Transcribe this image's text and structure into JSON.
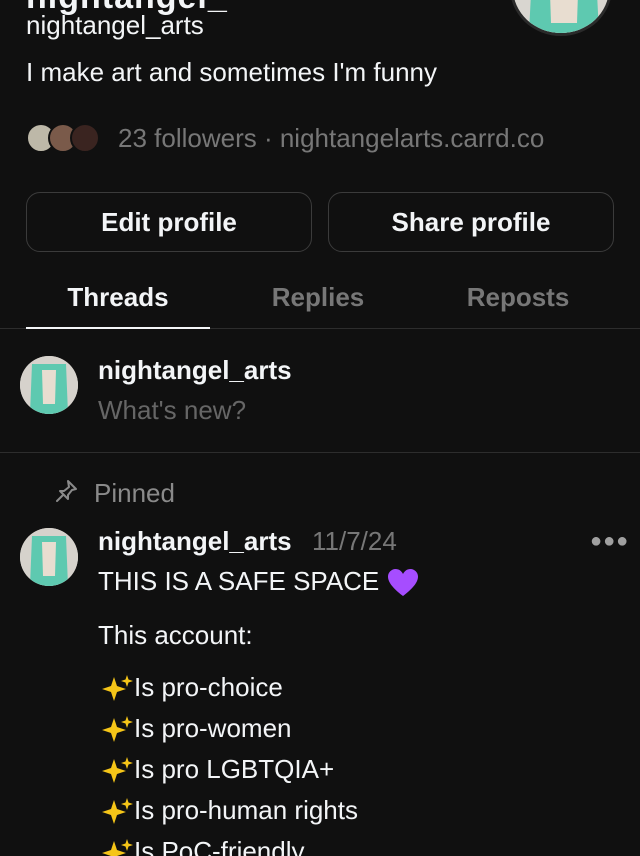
{
  "profile": {
    "clipped_name": "nightangel_",
    "handle": "nightangel_arts",
    "bio": "I make art and sometimes I'm funny",
    "followers_text": "23 followers · nightangelarts.carrd.co"
  },
  "buttons": {
    "edit": "Edit profile",
    "share": "Share profile"
  },
  "tabs": [
    {
      "label": "Threads"
    },
    {
      "label": "Replies"
    },
    {
      "label": "Reposts"
    }
  ],
  "composer": {
    "name": "nightangel_arts",
    "placeholder": "What's new?"
  },
  "pinned": {
    "label": "Pinned"
  },
  "post": {
    "author": "nightangel_arts",
    "date": "11/7/24",
    "heading": "THIS IS A SAFE SPACE",
    "intro": "This account:",
    "bullets": [
      "Is pro-choice",
      "Is pro-women",
      "Is pro LGBTQIA+",
      "Is pro-human rights",
      "Is PoC-friendly"
    ]
  },
  "icons": {
    "pin": "pin-icon",
    "more": "more-icon",
    "sparkles": "sparkles-emoji",
    "heart": "purple-heart-emoji"
  },
  "colors": {
    "background": "#101010",
    "text": "#f3f5f7",
    "muted": "#777777",
    "border": "#3b3b3b",
    "heart": "#a64dff",
    "sparkle": "#f5c518"
  }
}
